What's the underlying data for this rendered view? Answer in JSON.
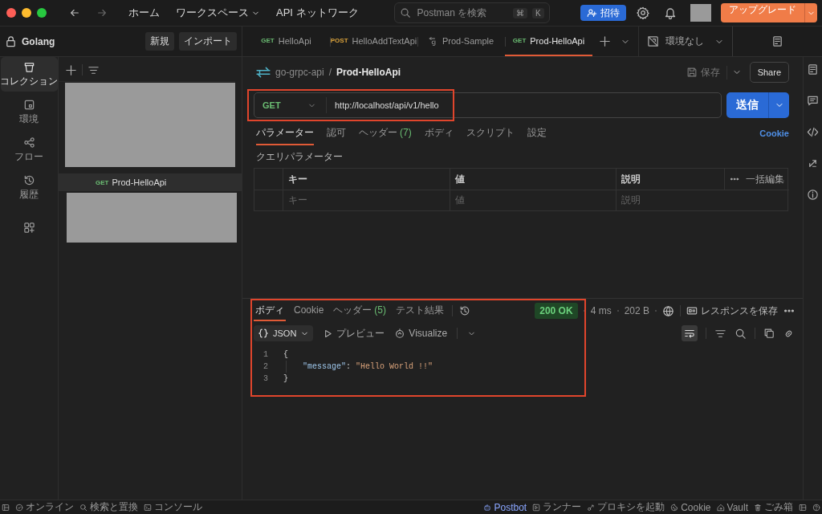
{
  "topbar": {
    "nav": [
      {
        "label": "ホーム",
        "dropdown": false
      },
      {
        "label": "ワークスペース",
        "dropdown": true
      },
      {
        "label": "API ネットワーク",
        "dropdown": false
      }
    ],
    "search": {
      "placeholder": "Postman を検索",
      "keys": [
        "⌘",
        "K"
      ]
    },
    "invite": "招待",
    "upgrade": "アップグレード"
  },
  "sidebar": {
    "workspace": "Golang",
    "buttons": [
      "新規",
      "インポート"
    ],
    "rail": [
      {
        "kind": "collections",
        "label": "コレクション",
        "selected": true
      },
      {
        "kind": "environments",
        "label": "環境",
        "selected": false
      },
      {
        "kind": "flows",
        "label": "フロー",
        "selected": false
      },
      {
        "kind": "history",
        "label": "履歴",
        "selected": false
      },
      {
        "kind": "apps",
        "selected": false
      }
    ],
    "tree": [
      {
        "kind": "redacted"
      },
      {
        "kind": "request",
        "method": "GET",
        "color": "#6bbd73",
        "name": "Prod-HelloApi",
        "selected": true
      },
      {
        "kind": "redacted"
      }
    ]
  },
  "tabs": [
    {
      "kind": "request",
      "method": "GET",
      "color": "#6bbd73",
      "label": "HelloApi",
      "selected": false
    },
    {
      "kind": "request",
      "method": "POST",
      "color": "#d9a23c",
      "label": "HelloAddTextApi",
      "selected": false
    },
    {
      "kind": "graphql",
      "label": "Prod-Sample",
      "selected": false
    },
    {
      "kind": "request",
      "method": "GET",
      "color": "#6bbd73",
      "label": "Prod-HelloApi",
      "selected": true
    }
  ],
  "environment": "環境なし",
  "request": {
    "collection": "go-grpc-api",
    "separator": "/",
    "name": "Prod-HelloApi",
    "save": "保存",
    "share": "Share",
    "method": "GET",
    "url": "http://localhost/api/v1/hello",
    "send": "送信",
    "tabs": [
      {
        "label": "パラメーター",
        "selected": true
      },
      {
        "label": "認可",
        "selected": false
      },
      {
        "label": "ヘッダー",
        "count": "(7)",
        "selected": false
      },
      {
        "label": "ボディ",
        "selected": false
      },
      {
        "label": "スクリプト",
        "selected": false
      },
      {
        "label": "設定",
        "selected": false
      }
    ],
    "cookies": "Cookie",
    "params_title": "クエリパラメーター",
    "table": {
      "columns": [
        "キー",
        "値",
        "説明"
      ],
      "bulk_edit": "一括編集",
      "placeholders": [
        "キー",
        "値",
        "説明"
      ]
    }
  },
  "response": {
    "tabs": [
      {
        "label": "ボディ",
        "selected": true
      },
      {
        "label": "Cookie",
        "selected": false
      },
      {
        "label": "ヘッダー",
        "count": "(5)",
        "selected": false
      },
      {
        "label": "テスト結果",
        "selected": false
      }
    ],
    "status": "200 OK",
    "time": "4 ms",
    "size": "202 B",
    "save": "レスポンスを保存",
    "format": "JSON",
    "preview": "プレビュー",
    "visualize": "Visualize",
    "lines": [
      {
        "number": "1",
        "tokens": [
          {
            "kind": "punct",
            "text": "{"
          }
        ]
      },
      {
        "number": "2",
        "tokens": [
          {
            "kind": "key",
            "text": "\"message\""
          },
          {
            "kind": "punct",
            "text": ": "
          },
          {
            "kind": "string",
            "text": "\"Hello World !!\""
          }
        ]
      },
      {
        "number": "3",
        "tokens": [
          {
            "kind": "punct",
            "text": "}"
          }
        ]
      }
    ]
  },
  "status_bar": {
    "left": [
      {
        "kind": "layout"
      },
      {
        "kind": "online",
        "label": "オンライン"
      },
      {
        "kind": "search",
        "label": "検索と置換"
      },
      {
        "kind": "console",
        "label": "コンソール"
      }
    ],
    "right": [
      {
        "kind": "postbot",
        "label": "Postbot"
      },
      {
        "kind": "runner",
        "label": "ランナー"
      },
      {
        "kind": "proxy",
        "label": "プロキシを起動"
      },
      {
        "kind": "cookie",
        "label": "Cookie"
      },
      {
        "kind": "vault",
        "label": "Vault"
      },
      {
        "kind": "trash",
        "label": "ごみ箱"
      },
      {
        "kind": "layout"
      },
      {
        "kind": "help"
      }
    ]
  }
}
